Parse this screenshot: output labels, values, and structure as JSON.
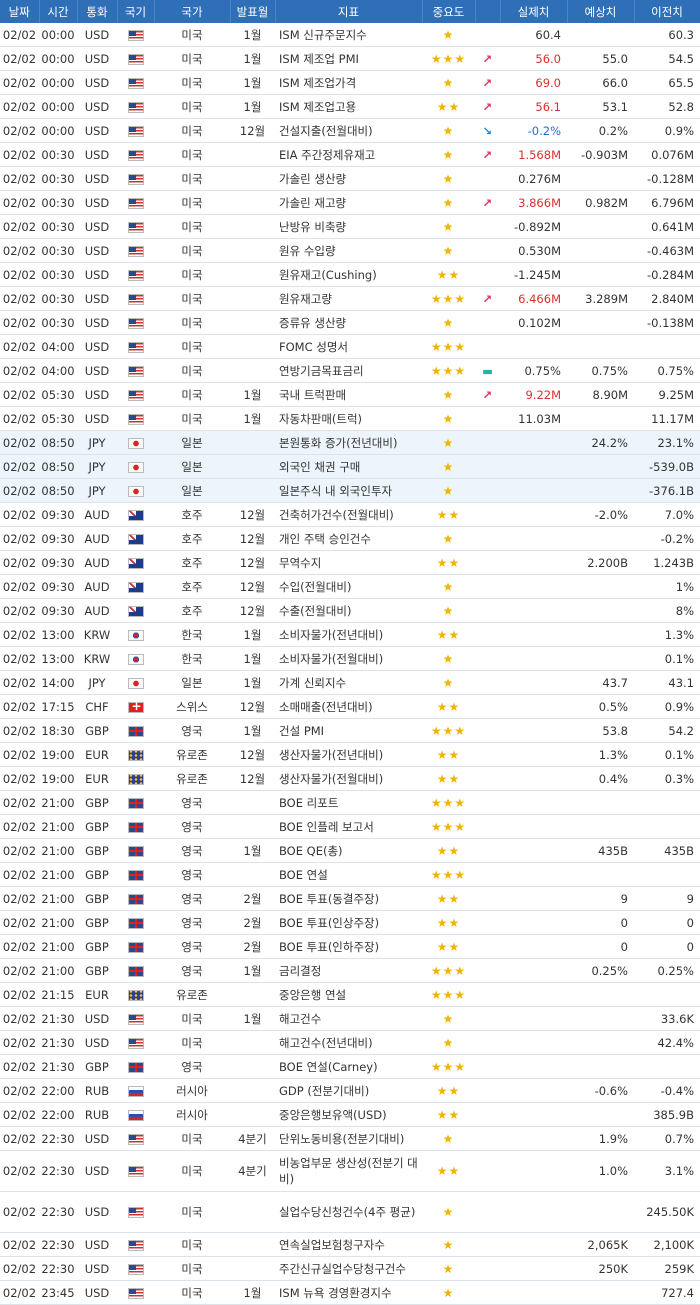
{
  "headers": [
    "날짜",
    "시간",
    "통화",
    "국기",
    "국가",
    "발표월",
    "지표",
    "중요도",
    "",
    "실제치",
    "예상치",
    "이전치"
  ],
  "rows": [
    {
      "date": "02/02",
      "time": "00:00",
      "cur": "USD",
      "flag": "us",
      "country": "미국",
      "month": "1월",
      "name": "ISM 신규주문지수",
      "stars": "★",
      "arrow": "",
      "arrow_dir": "",
      "actual": "60.4",
      "actual_color": "",
      "forecast": "",
      "prev": "60.3"
    },
    {
      "date": "02/02",
      "time": "00:00",
      "cur": "USD",
      "flag": "us",
      "country": "미국",
      "month": "1월",
      "name": "ISM 제조업 PMI",
      "stars": "★★★",
      "arrow": "↗",
      "arrow_dir": "up",
      "actual": "56.0",
      "actual_color": "red",
      "forecast": "55.0",
      "prev": "54.5"
    },
    {
      "date": "02/02",
      "time": "00:00",
      "cur": "USD",
      "flag": "us",
      "country": "미국",
      "month": "1월",
      "name": "ISM 제조업가격",
      "stars": "★",
      "arrow": "↗",
      "arrow_dir": "up",
      "actual": "69.0",
      "actual_color": "red",
      "forecast": "66.0",
      "prev": "65.5"
    },
    {
      "date": "02/02",
      "time": "00:00",
      "cur": "USD",
      "flag": "us",
      "country": "미국",
      "month": "1월",
      "name": "ISM 제조업고용",
      "stars": "★★",
      "arrow": "↗",
      "arrow_dir": "up",
      "actual": "56.1",
      "actual_color": "red",
      "forecast": "53.1",
      "prev": "52.8"
    },
    {
      "date": "02/02",
      "time": "00:00",
      "cur": "USD",
      "flag": "us",
      "country": "미국",
      "month": "12월",
      "name": "건설지출(전월대비)",
      "stars": "★",
      "arrow": "↘",
      "arrow_dir": "down",
      "actual": "-0.2%",
      "actual_color": "blue",
      "forecast": "0.2%",
      "prev": "0.9%"
    },
    {
      "date": "02/02",
      "time": "00:30",
      "cur": "USD",
      "flag": "us",
      "country": "미국",
      "month": "",
      "name": "EIA 주간정제유재고",
      "stars": "★",
      "arrow": "↗",
      "arrow_dir": "up",
      "actual": "1.568M",
      "actual_color": "red",
      "forecast": "-0.903M",
      "prev": "0.076M"
    },
    {
      "date": "02/02",
      "time": "00:30",
      "cur": "USD",
      "flag": "us",
      "country": "미국",
      "month": "",
      "name": "가솔린 생산량",
      "stars": "★",
      "arrow": "",
      "arrow_dir": "",
      "actual": "0.276M",
      "actual_color": "",
      "forecast": "",
      "prev": "-0.128M"
    },
    {
      "date": "02/02",
      "time": "00:30",
      "cur": "USD",
      "flag": "us",
      "country": "미국",
      "month": "",
      "name": "가솔린 재고량",
      "stars": "★",
      "arrow": "↗",
      "arrow_dir": "up",
      "actual": "3.866M",
      "actual_color": "red",
      "forecast": "0.982M",
      "prev": "6.796M"
    },
    {
      "date": "02/02",
      "time": "00:30",
      "cur": "USD",
      "flag": "us",
      "country": "미국",
      "month": "",
      "name": "난방유 비축량",
      "stars": "★",
      "arrow": "",
      "arrow_dir": "",
      "actual": "-0.892M",
      "actual_color": "",
      "forecast": "",
      "prev": "0.641M"
    },
    {
      "date": "02/02",
      "time": "00:30",
      "cur": "USD",
      "flag": "us",
      "country": "미국",
      "month": "",
      "name": "원유 수입량",
      "stars": "★",
      "arrow": "",
      "arrow_dir": "",
      "actual": "0.530M",
      "actual_color": "",
      "forecast": "",
      "prev": "-0.463M"
    },
    {
      "date": "02/02",
      "time": "00:30",
      "cur": "USD",
      "flag": "us",
      "country": "미국",
      "month": "",
      "name": "원유재고(Cushing)",
      "stars": "★★",
      "arrow": "",
      "arrow_dir": "",
      "actual": "-1.245M",
      "actual_color": "",
      "forecast": "",
      "prev": "-0.284M"
    },
    {
      "date": "02/02",
      "time": "00:30",
      "cur": "USD",
      "flag": "us",
      "country": "미국",
      "month": "",
      "name": "원유재고량",
      "stars": "★★★",
      "arrow": "↗",
      "arrow_dir": "up",
      "actual": "6.466M",
      "actual_color": "red",
      "forecast": "3.289M",
      "prev": "2.840M"
    },
    {
      "date": "02/02",
      "time": "00:30",
      "cur": "USD",
      "flag": "us",
      "country": "미국",
      "month": "",
      "name": "증류유 생산량",
      "stars": "★",
      "arrow": "",
      "arrow_dir": "",
      "actual": "0.102M",
      "actual_color": "",
      "forecast": "",
      "prev": "-0.138M"
    },
    {
      "date": "02/02",
      "time": "04:00",
      "cur": "USD",
      "flag": "us",
      "country": "미국",
      "month": "",
      "name": "FOMC 성명서",
      "stars": "★★★",
      "arrow": "",
      "arrow_dir": "",
      "actual": "",
      "actual_color": "",
      "forecast": "",
      "prev": ""
    },
    {
      "date": "02/02",
      "time": "04:00",
      "cur": "USD",
      "flag": "us",
      "country": "미국",
      "month": "",
      "name": "연방기금목표금리",
      "stars": "★★★",
      "arrow": "▬",
      "arrow_dir": "eq",
      "actual": "0.75%",
      "actual_color": "",
      "forecast": "0.75%",
      "prev": "0.75%"
    },
    {
      "date": "02/02",
      "time": "05:30",
      "cur": "USD",
      "flag": "us",
      "country": "미국",
      "month": "1월",
      "name": "국내 트럭판매",
      "stars": "★",
      "arrow": "↗",
      "arrow_dir": "up",
      "actual": "9.22M",
      "actual_color": "red",
      "forecast": "8.90M",
      "prev": "9.25M"
    },
    {
      "date": "02/02",
      "time": "05:30",
      "cur": "USD",
      "flag": "us",
      "country": "미국",
      "month": "1월",
      "name": "자동차판매(트럭)",
      "stars": "★",
      "arrow": "",
      "arrow_dir": "",
      "actual": "11.03M",
      "actual_color": "",
      "forecast": "",
      "prev": "11.17M"
    },
    {
      "date": "02/02",
      "time": "08:50",
      "cur": "JPY",
      "flag": "jp",
      "country": "일본",
      "month": "",
      "name": "본원통화 증가(전년대비)",
      "stars": "★",
      "arrow": "",
      "arrow_dir": "",
      "actual": "",
      "actual_color": "",
      "forecast": "24.2%",
      "prev": "23.1%"
    },
    {
      "date": "02/02",
      "time": "08:50",
      "cur": "JPY",
      "flag": "jp",
      "country": "일본",
      "month": "",
      "name": "외국인 채권 구매",
      "stars": "★",
      "arrow": "",
      "arrow_dir": "",
      "actual": "",
      "actual_color": "",
      "forecast": "",
      "prev": "-539.0B"
    },
    {
      "date": "02/02",
      "time": "08:50",
      "cur": "JPY",
      "flag": "jp",
      "country": "일본",
      "month": "",
      "name": "일본주식 내 외국인투자",
      "stars": "★",
      "arrow": "",
      "arrow_dir": "",
      "actual": "",
      "actual_color": "",
      "forecast": "",
      "prev": "-376.1B"
    },
    {
      "date": "02/02",
      "time": "09:30",
      "cur": "AUD",
      "flag": "au",
      "country": "호주",
      "month": "12월",
      "name": "건축허가건수(전월대비)",
      "stars": "★★",
      "arrow": "",
      "arrow_dir": "",
      "actual": "",
      "actual_color": "",
      "forecast": "-2.0%",
      "prev": "7.0%"
    },
    {
      "date": "02/02",
      "time": "09:30",
      "cur": "AUD",
      "flag": "au",
      "country": "호주",
      "month": "12월",
      "name": "개인 주택 승인건수",
      "stars": "★",
      "arrow": "",
      "arrow_dir": "",
      "actual": "",
      "actual_color": "",
      "forecast": "",
      "prev": "-0.2%"
    },
    {
      "date": "02/02",
      "time": "09:30",
      "cur": "AUD",
      "flag": "au",
      "country": "호주",
      "month": "12월",
      "name": "무역수지",
      "stars": "★★",
      "arrow": "",
      "arrow_dir": "",
      "actual": "",
      "actual_color": "",
      "forecast": "2.200B",
      "prev": "1.243B"
    },
    {
      "date": "02/02",
      "time": "09:30",
      "cur": "AUD",
      "flag": "au",
      "country": "호주",
      "month": "12월",
      "name": "수입(전월대비)",
      "stars": "★",
      "arrow": "",
      "arrow_dir": "",
      "actual": "",
      "actual_color": "",
      "forecast": "",
      "prev": "1%"
    },
    {
      "date": "02/02",
      "time": "09:30",
      "cur": "AUD",
      "flag": "au",
      "country": "호주",
      "month": "12월",
      "name": "수출(전월대비)",
      "stars": "★",
      "arrow": "",
      "arrow_dir": "",
      "actual": "",
      "actual_color": "",
      "forecast": "",
      "prev": "8%"
    },
    {
      "date": "02/02",
      "time": "13:00",
      "cur": "KRW",
      "flag": "kr",
      "country": "한국",
      "month": "1월",
      "name": "소비자물가(전년대비)",
      "stars": "★★",
      "arrow": "",
      "arrow_dir": "",
      "actual": "",
      "actual_color": "",
      "forecast": "",
      "prev": "1.3%"
    },
    {
      "date": "02/02",
      "time": "13:00",
      "cur": "KRW",
      "flag": "kr",
      "country": "한국",
      "month": "1월",
      "name": "소비자물가(전월대비)",
      "stars": "★",
      "arrow": "",
      "arrow_dir": "",
      "actual": "",
      "actual_color": "",
      "forecast": "",
      "prev": "0.1%"
    },
    {
      "date": "02/02",
      "time": "14:00",
      "cur": "JPY",
      "flag": "jp",
      "country": "일본",
      "month": "1월",
      "name": "가계 신뢰지수",
      "stars": "★",
      "arrow": "",
      "arrow_dir": "",
      "actual": "",
      "actual_color": "",
      "forecast": "43.7",
      "prev": "43.1"
    },
    {
      "date": "02/02",
      "time": "17:15",
      "cur": "CHF",
      "flag": "ch",
      "country": "스위스",
      "month": "12월",
      "name": "소매매출(전년대비)",
      "stars": "★★",
      "arrow": "",
      "arrow_dir": "",
      "actual": "",
      "actual_color": "",
      "forecast": "0.5%",
      "prev": "0.9%"
    },
    {
      "date": "02/02",
      "time": "18:30",
      "cur": "GBP",
      "flag": "gb",
      "country": "영국",
      "month": "1월",
      "name": "건설 PMI",
      "stars": "★★★",
      "arrow": "",
      "arrow_dir": "",
      "actual": "",
      "actual_color": "",
      "forecast": "53.8",
      "prev": "54.2"
    },
    {
      "date": "02/02",
      "time": "19:00",
      "cur": "EUR",
      "flag": "eu",
      "country": "유로존",
      "month": "12월",
      "name": "생산자물가(전년대비)",
      "stars": "★★",
      "arrow": "",
      "arrow_dir": "",
      "actual": "",
      "actual_color": "",
      "forecast": "1.3%",
      "prev": "0.1%"
    },
    {
      "date": "02/02",
      "time": "19:00",
      "cur": "EUR",
      "flag": "eu",
      "country": "유로존",
      "month": "12월",
      "name": "생산자물가(전월대비)",
      "stars": "★★",
      "arrow": "",
      "arrow_dir": "",
      "actual": "",
      "actual_color": "",
      "forecast": "0.4%",
      "prev": "0.3%"
    },
    {
      "date": "02/02",
      "time": "21:00",
      "cur": "GBP",
      "flag": "gb",
      "country": "영국",
      "month": "",
      "name": "BOE 리포트",
      "stars": "★★★",
      "arrow": "",
      "arrow_dir": "",
      "actual": "",
      "actual_color": "",
      "forecast": "",
      "prev": ""
    },
    {
      "date": "02/02",
      "time": "21:00",
      "cur": "GBP",
      "flag": "gb",
      "country": "영국",
      "month": "",
      "name": "BOE 인플레 보고서",
      "stars": "★★★",
      "arrow": "",
      "arrow_dir": "",
      "actual": "",
      "actual_color": "",
      "forecast": "",
      "prev": ""
    },
    {
      "date": "02/02",
      "time": "21:00",
      "cur": "GBP",
      "flag": "gb",
      "country": "영국",
      "month": "1월",
      "name": "BOE QE(총)",
      "stars": "★★",
      "arrow": "",
      "arrow_dir": "",
      "actual": "",
      "actual_color": "",
      "forecast": "435B",
      "prev": "435B"
    },
    {
      "date": "02/02",
      "time": "21:00",
      "cur": "GBP",
      "flag": "gb",
      "country": "영국",
      "month": "",
      "name": "BOE 연설",
      "stars": "★★★",
      "arrow": "",
      "arrow_dir": "",
      "actual": "",
      "actual_color": "",
      "forecast": "",
      "prev": ""
    },
    {
      "date": "02/02",
      "time": "21:00",
      "cur": "GBP",
      "flag": "gb",
      "country": "영국",
      "month": "2월",
      "name": "BOE 투표(동결주장)",
      "stars": "★★",
      "arrow": "",
      "arrow_dir": "",
      "actual": "",
      "actual_color": "",
      "forecast": "9",
      "prev": "9"
    },
    {
      "date": "02/02",
      "time": "21:00",
      "cur": "GBP",
      "flag": "gb",
      "country": "영국",
      "month": "2월",
      "name": "BOE 투표(인상주장)",
      "stars": "★★",
      "arrow": "",
      "arrow_dir": "",
      "actual": "",
      "actual_color": "",
      "forecast": "0",
      "prev": "0"
    },
    {
      "date": "02/02",
      "time": "21:00",
      "cur": "GBP",
      "flag": "gb",
      "country": "영국",
      "month": "2월",
      "name": "BOE 투표(인하주장)",
      "stars": "★★",
      "arrow": "",
      "arrow_dir": "",
      "actual": "",
      "actual_color": "",
      "forecast": "0",
      "prev": "0"
    },
    {
      "date": "02/02",
      "time": "21:00",
      "cur": "GBP",
      "flag": "gb",
      "country": "영국",
      "month": "1월",
      "name": "금리결정",
      "stars": "★★★",
      "arrow": "",
      "arrow_dir": "",
      "actual": "",
      "actual_color": "",
      "forecast": "0.25%",
      "prev": "0.25%"
    },
    {
      "date": "02/02",
      "time": "21:15",
      "cur": "EUR",
      "flag": "eu",
      "country": "유로존",
      "month": "",
      "name": "중앙은행 연설",
      "stars": "★★★",
      "arrow": "",
      "arrow_dir": "",
      "actual": "",
      "actual_color": "",
      "forecast": "",
      "prev": ""
    },
    {
      "date": "02/02",
      "time": "21:30",
      "cur": "USD",
      "flag": "us",
      "country": "미국",
      "month": "1월",
      "name": "해고건수",
      "stars": "★",
      "arrow": "",
      "arrow_dir": "",
      "actual": "",
      "actual_color": "",
      "forecast": "",
      "prev": "33.6K"
    },
    {
      "date": "02/02",
      "time": "21:30",
      "cur": "USD",
      "flag": "us",
      "country": "미국",
      "month": "",
      "name": "해고건수(전년대비)",
      "stars": "★",
      "arrow": "",
      "arrow_dir": "",
      "actual": "",
      "actual_color": "",
      "forecast": "",
      "prev": "42.4%"
    },
    {
      "date": "02/02",
      "time": "21:30",
      "cur": "GBP",
      "flag": "gb",
      "country": "영국",
      "month": "",
      "name": "BOE 연설(Carney)",
      "stars": "★★★",
      "arrow": "",
      "arrow_dir": "",
      "actual": "",
      "actual_color": "",
      "forecast": "",
      "prev": ""
    },
    {
      "date": "02/02",
      "time": "22:00",
      "cur": "RUB",
      "flag": "ru",
      "country": "러시아",
      "month": "",
      "name": "GDP (전분기대비)",
      "stars": "★★",
      "arrow": "",
      "arrow_dir": "",
      "actual": "",
      "actual_color": "",
      "forecast": "-0.6%",
      "prev": "-0.4%"
    },
    {
      "date": "02/02",
      "time": "22:00",
      "cur": "RUB",
      "flag": "ru",
      "country": "러시아",
      "month": "",
      "name": "중앙은행보유액(USD)",
      "stars": "★★",
      "arrow": "",
      "arrow_dir": "",
      "actual": "",
      "actual_color": "",
      "forecast": "",
      "prev": "385.9B"
    },
    {
      "date": "02/02",
      "time": "22:30",
      "cur": "USD",
      "flag": "us",
      "country": "미국",
      "month": "4분기",
      "name": "단위노동비용(전분기대비)",
      "stars": "★",
      "arrow": "",
      "arrow_dir": "",
      "actual": "",
      "actual_color": "",
      "forecast": "1.9%",
      "prev": "0.7%"
    },
    {
      "date": "02/02",
      "time": "22:30",
      "cur": "USD",
      "flag": "us",
      "country": "미국",
      "month": "4분기",
      "name": "비농업부문 생산성(전분기 대비)",
      "stars": "★★",
      "arrow": "",
      "arrow_dir": "",
      "actual": "",
      "actual_color": "",
      "forecast": "1.0%",
      "prev": "3.1%",
      "tall": true
    },
    {
      "date": "02/02",
      "time": "22:30",
      "cur": "USD",
      "flag": "us",
      "country": "미국",
      "month": "",
      "name": "실업수당신청건수(4주 평균)",
      "stars": "★",
      "arrow": "",
      "arrow_dir": "",
      "actual": "",
      "actual_color": "",
      "forecast": "",
      "prev": "245.50K",
      "tall": true
    },
    {
      "date": "02/02",
      "time": "22:30",
      "cur": "USD",
      "flag": "us",
      "country": "미국",
      "month": "",
      "name": "연속실업보험청구자수",
      "stars": "★",
      "arrow": "",
      "arrow_dir": "",
      "actual": "",
      "actual_color": "",
      "forecast": "2,065K",
      "prev": "2,100K"
    },
    {
      "date": "02/02",
      "time": "22:30",
      "cur": "USD",
      "flag": "us",
      "country": "미국",
      "month": "",
      "name": "주간신규실업수당청구건수",
      "stars": "★",
      "arrow": "",
      "arrow_dir": "",
      "actual": "",
      "actual_color": "",
      "forecast": "250K",
      "prev": "259K"
    },
    {
      "date": "02/02",
      "time": "23:45",
      "cur": "USD",
      "flag": "us",
      "country": "미국",
      "month": "1월",
      "name": "ISM 뉴욕 경영환경지수",
      "stars": "★",
      "arrow": "",
      "arrow_dir": "",
      "actual": "",
      "actual_color": "",
      "forecast": "",
      "prev": "727.4"
    }
  ]
}
